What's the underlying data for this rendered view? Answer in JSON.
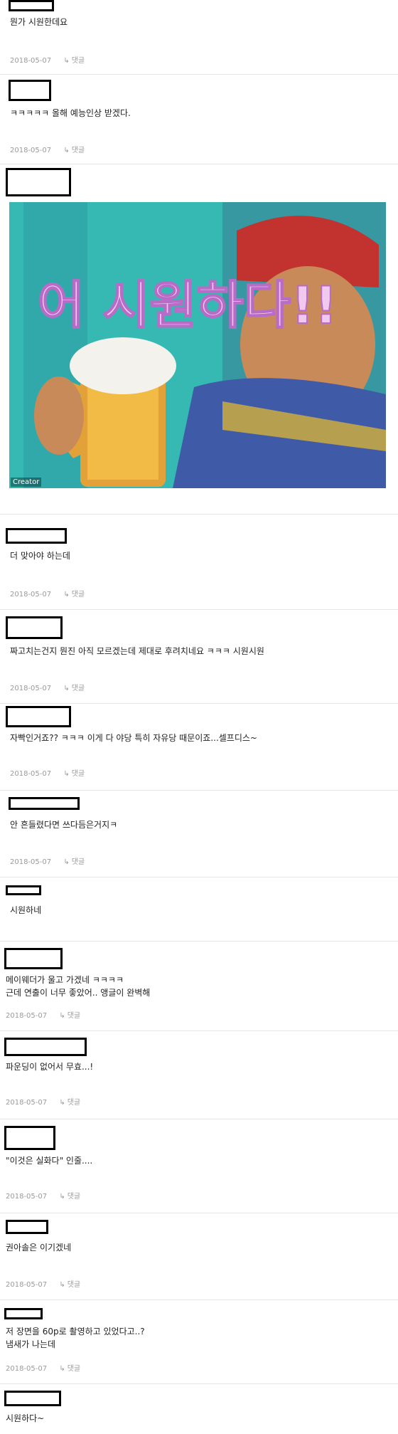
{
  "comments": [
    {
      "text": "뭔가 시원한데요",
      "date": "2018-05-07",
      "reply": "댓글"
    },
    {
      "text": "ㅋㅋㅋㅋㅋ 올해 예능인상 받겠다.",
      "date": "2018-05-07",
      "reply": "댓글"
    },
    {
      "text": "",
      "date": "2018-05-07",
      "reply": "댓글",
      "image": {
        "caption": "어 시원하다!!",
        "watermark": "Creator",
        "icon": "beer-mug-icon"
      }
    },
    {
      "text": "더 맞아야 하는데",
      "date": "2018-05-07",
      "reply": "댓글"
    },
    {
      "text": "짜고치는건지 뭔진 아직 모르겠는데 제대로 후려치네요 ㅋㅋㅋ 시원시원",
      "date": "2018-05-07",
      "reply": "댓글"
    },
    {
      "text": "자빡인거죠?? ㅋㅋㅋ 이게 다 야당 특히 자유당 때문이죠...셀프디스~",
      "date": "2018-05-07",
      "reply": "댓글"
    },
    {
      "text": "안 흔들렸다면 쓰다듬은거지ㅋ",
      "date": "2018-05-07",
      "reply": "댓글"
    },
    {
      "text": "시원하네",
      "date": "",
      "reply": ""
    },
    {
      "text": "메이웨더가 울고 가겠네 ㅋㅋㅋㅋ",
      "text2": "근데 연출이 너무 좋았어.. 앵글이 완벽해",
      "date": "2018-05-07",
      "reply": "댓글"
    },
    {
      "text": "파운딩이 없어서 무효...!",
      "date": "2018-05-07",
      "reply": "댓글"
    },
    {
      "text": "\"이것은 실화다\" 인줄....",
      "date": "2018-05-07",
      "reply": "댓글"
    },
    {
      "text": "권아솔은 이기겠네",
      "date": "2018-05-07",
      "reply": "댓글"
    },
    {
      "text": "저 장면을 60p로 촬영하고 있었다고..?",
      "text2": "냄새가 나는데",
      "date": "2018-05-07",
      "reply": "댓글"
    },
    {
      "text": "시원하다~",
      "date": "",
      "reply": ""
    }
  ],
  "colors": {
    "divider": "#e6e6e6",
    "meta": "#9a9a9a",
    "nick_border": "#000000"
  }
}
